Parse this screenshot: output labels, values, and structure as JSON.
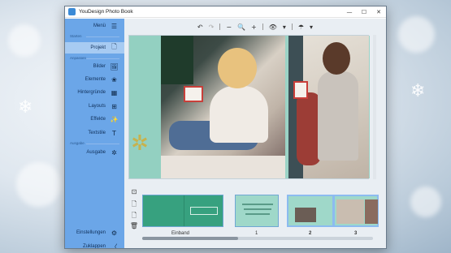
{
  "window": {
    "title": "YouDesign Photo Book",
    "controls": [
      "—",
      "☐",
      "✕"
    ]
  },
  "sidebar": {
    "menu_label": "Menü",
    "sections": {
      "start": "Starten",
      "customize": "Anpassen",
      "output": "Ausgabe"
    },
    "items": [
      {
        "label": "Projekt",
        "icon": "page-icon",
        "glyph": "🗋"
      },
      {
        "label": "Bilder",
        "icon": "image-icon",
        "glyph": "🖼"
      },
      {
        "label": "Elemente",
        "icon": "elements-icon",
        "glyph": "❀"
      },
      {
        "label": "Hintergründe",
        "icon": "background-icon",
        "glyph": "▦"
      },
      {
        "label": "Layouts",
        "icon": "layout-icon",
        "glyph": "⊞"
      },
      {
        "label": "Effekte",
        "icon": "effects-icon",
        "glyph": "✨"
      },
      {
        "label": "Textstile",
        "icon": "text-style-icon",
        "glyph": "T"
      },
      {
        "label": "Ausgabe",
        "icon": "output-icon",
        "glyph": "✲"
      }
    ],
    "footer": [
      {
        "label": "Einstellungen",
        "icon": "settings-icon",
        "glyph": "⚙"
      },
      {
        "label": "Zuklappen",
        "icon": "collapse-icon",
        "glyph": "〈"
      }
    ]
  },
  "toolbar": {
    "undo": "↶",
    "redo": "↷",
    "zoom_out": "−",
    "zoom": "🔍",
    "zoom_in": "+",
    "view": "👁",
    "view_caret": "▾",
    "help": "☂",
    "help_caret": "▾"
  },
  "pages": {
    "thumbnails": [
      {
        "label": "Einband",
        "selected": false
      },
      {
        "label": "1",
        "selected": false
      },
      {
        "label": "2",
        "selected": true
      },
      {
        "label": "3",
        "selected": true
      }
    ]
  },
  "thumbnail_tools": [
    "⊡",
    "🗋",
    "🗋",
    "🗑"
  ],
  "colors": {
    "sidebar": "#6ba6e8",
    "sidebar_active": "#a7cbf2",
    "page_background": "#93d0c1",
    "cover": "#37a17f",
    "selection_border": "#8cbbf0"
  }
}
